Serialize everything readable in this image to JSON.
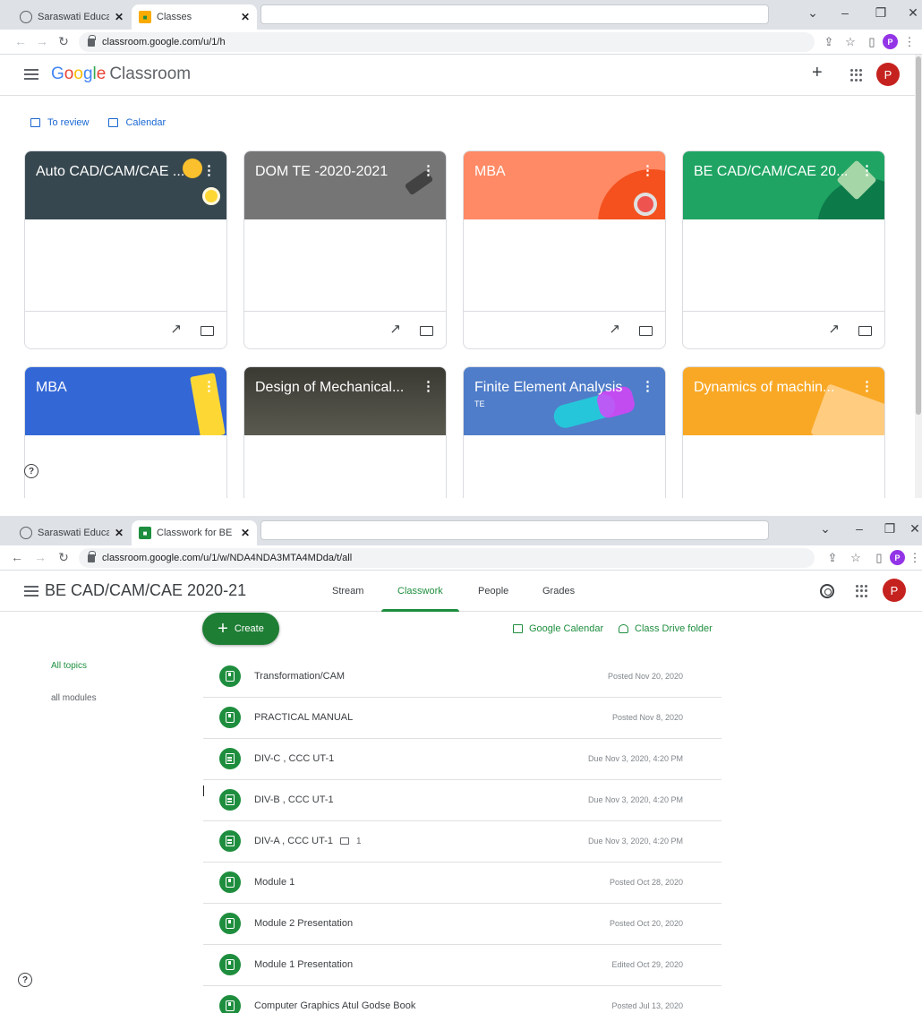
{
  "window1": {
    "tabs": [
      {
        "title": "Saraswati Education S",
        "active": false
      },
      {
        "title": "Classes",
        "active": true
      }
    ],
    "url": "classroom.google.com/u/1/h",
    "brand": {
      "google": [
        "G",
        "o",
        "o",
        "g",
        "l",
        "e"
      ],
      "product": "Classroom"
    },
    "avatar_letter": "P",
    "profile_letter": "P",
    "quick_links": {
      "review": "To review",
      "calendar": "Calendar"
    },
    "cards": [
      {
        "name": "Auto CAD/CAM/CAE ...",
        "subtitle": "",
        "color": "#37474f"
      },
      {
        "name": "DOM TE -2020-2021",
        "subtitle": "",
        "color": "#757575"
      },
      {
        "name": "MBA",
        "subtitle": "",
        "color": "#ff8a65"
      },
      {
        "name": "BE CAD/CAM/CAE 20...",
        "subtitle": "",
        "color": "#1fa463"
      },
      {
        "name": "MBA",
        "subtitle": "",
        "color": "#3367d6"
      },
      {
        "name": "Design of Mechanical...",
        "subtitle": "",
        "color": "#4a4a42"
      },
      {
        "name": "Finite Element Analysis",
        "subtitle": "TE",
        "color": "#4f7dc9"
      },
      {
        "name": "Dynamics of machin...",
        "subtitle": "",
        "color": "#f9a825"
      }
    ],
    "help": "?"
  },
  "window2": {
    "tabs": [
      {
        "title": "Saraswati Education S",
        "active": false
      },
      {
        "title": "Classwork for BE CAD/",
        "active": true
      }
    ],
    "url": "classroom.google.com/u/1/w/NDA4NDA3MTA4MDda/t/all",
    "class_title": "BE CAD/CAM/CAE 2020-21",
    "nav_tabs": [
      "Stream",
      "Classwork",
      "People",
      "Grades"
    ],
    "avatar_letter": "P",
    "profile_letter": "P",
    "create_label": "Create",
    "calendar_link": "Google Calendar",
    "drive_link": "Class Drive folder",
    "topics": [
      "All topics",
      "all modules"
    ],
    "items": [
      {
        "title": "Transformation/CAM",
        "date": "Posted Nov 20, 2020",
        "type": "material",
        "comments": ""
      },
      {
        "title": "PRACTICAL MANUAL",
        "date": "Posted Nov 8, 2020",
        "type": "material",
        "comments": ""
      },
      {
        "title": "DIV-C , CCC UT-1",
        "date": "Due Nov 3, 2020, 4:20 PM",
        "type": "assignment",
        "comments": ""
      },
      {
        "title": "DIV-B , CCC UT-1",
        "date": "Due Nov 3, 2020, 4:20 PM",
        "type": "assignment",
        "comments": ""
      },
      {
        "title": "DIV-A , CCC UT-1",
        "date": "Due Nov 3, 2020, 4:20 PM",
        "type": "assignment",
        "comments": "1"
      },
      {
        "title": "Module 1",
        "date": "Posted Oct 28, 2020",
        "type": "material",
        "comments": ""
      },
      {
        "title": "Module 2 Presentation",
        "date": "Posted Oct 20, 2020",
        "type": "material",
        "comments": ""
      },
      {
        "title": "Module 1 Presentation",
        "date": "Edited Oct 29, 2020",
        "type": "material",
        "comments": ""
      },
      {
        "title": "Computer Graphics Atul Godse Book",
        "date": "Posted Jul 13, 2020",
        "type": "material",
        "comments": ""
      }
    ],
    "help": "?"
  },
  "colors": {
    "accent_green": "#1e8e3e",
    "link_blue": "#1967d2",
    "avatar_red": "#c5221f",
    "profile_purple": "#9334e6"
  }
}
